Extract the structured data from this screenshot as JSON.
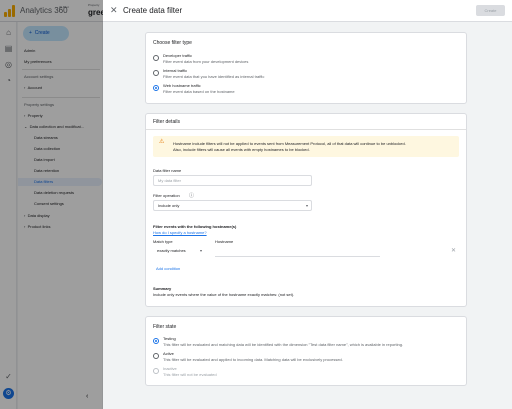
{
  "app": {
    "title": "Analytics 360",
    "tag": "@ Pilot",
    "property_small": "Property",
    "property_name": "gree"
  },
  "nav": {
    "create_label": "Create",
    "admin": "Admin",
    "my_preferences": "My preferences",
    "account_settings": "Account settings",
    "account": "Account",
    "property_settings": "Property settings",
    "property": "Property",
    "data_collection": "Data collection and modificat...",
    "sub_items": [
      "Data streams",
      "Data collection",
      "Data import",
      "Data retention",
      "Data filters",
      "Data deletion requests",
      "Consent settings"
    ],
    "data_display": "Data display",
    "product_links": "Product links"
  },
  "dialog": {
    "title": "Create data filter",
    "create_button": "Create",
    "filter_type": {
      "heading": "Choose filter type",
      "options": [
        {
          "label": "Developer traffic",
          "desc": "Filter event data from your development devices",
          "selected": false
        },
        {
          "label": "Internal traffic",
          "desc": "Filter event data that you have identified as internal traffic",
          "selected": false
        },
        {
          "label": "Web hostname traffic",
          "desc": "Filter event data based on the hostname",
          "selected": true
        }
      ]
    },
    "filter_details": {
      "heading": "Filter details",
      "warning_line1": "Hostname include filters will not be applied to events sent from Measurement Protocol, all of that data will continue to be unblocked.",
      "warning_line2": "Also, include filters will cause all events with empty hostnames to be blocked.",
      "name_label": "Data filter name",
      "name_placeholder": "My data filter",
      "operation_label": "Filter operation",
      "operation_value": "Include only",
      "hostnames_label": "Filter events with the following hostname(s)",
      "how_link": "How do I specify a hostname?",
      "match_type_label": "Match type",
      "match_type_value": "exactly matches",
      "hostname_label": "Hostname",
      "hostname_value": "",
      "add_condition": "Add condition",
      "summary_label": "Summary",
      "summary_text": "Include only events where the value of the hostname exactly matches: (not set)."
    },
    "filter_state": {
      "heading": "Filter state",
      "options": [
        {
          "label": "Testing",
          "desc": "This filter will be evaluated and matching data will be identified with the dimension \"Test data filter name\", which is available in reporting.",
          "selected": true,
          "disabled": false
        },
        {
          "label": "Active",
          "desc": "This filter will be evaluated and applied to incoming data. Matching data will be exclusively processed.",
          "selected": false,
          "disabled": false
        },
        {
          "label": "Inactive",
          "desc": "This filter will not be evaluated",
          "selected": false,
          "disabled": true
        }
      ]
    }
  },
  "colors": {
    "accent": "#1a73e8",
    "warning_bg": "#fef7e0",
    "warning_icon": "#e37400",
    "scrim": "rgba(0,0,0,0.38)"
  }
}
